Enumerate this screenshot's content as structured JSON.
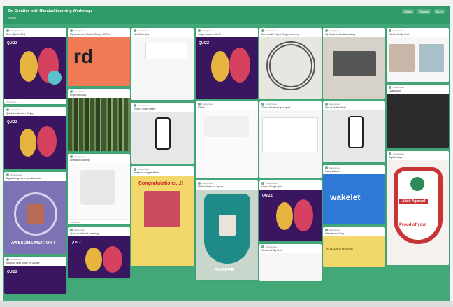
{
  "board": {
    "title": "Be Creative with Blended Learning Workshop",
    "subtitle": "Padlet",
    "actions": [
      "Share",
      "Remake",
      "More"
    ]
  },
  "cards": [
    {
      "author": "Anonymous",
      "title": "Zoom Quizz MCQ",
      "footer": "Comments",
      "media": "quizz",
      "logo": "QUIZZ"
    },
    {
      "author": "Anonymous",
      "title": "Quizz Introduction - Enjoy",
      "footer": "",
      "media": "quizz",
      "logo": "QUIZZ"
    },
    {
      "author": "Anonymous",
      "title": "Digital badge for a special mentor",
      "footer": "",
      "media": "purple",
      "caption": "AWESOME MENTOR !"
    },
    {
      "author": "Anonymous",
      "title": "Nearpod Quiz Share on Google",
      "footer": "",
      "media": "quizz",
      "logo": "QUIZZ"
    },
    {
      "author": "Anonymous",
      "title": "My session on Student Study - SRT-ed",
      "footer": "",
      "media": "orange",
      "big": "rd"
    },
    {
      "author": "Anonymous",
      "title": "Project to study",
      "footer": "",
      "media": "forest"
    },
    {
      "author": "Anonymous",
      "title": "Animated Learning",
      "footer": "Comments",
      "media": "form"
    },
    {
      "author": "Anonymous",
      "title": "Quizz on Wakelet Learning",
      "footer": "",
      "media": "quizz",
      "logo": "QUIZZ"
    },
    {
      "author": "Anonymous",
      "title": "WordWall Quiz",
      "footer": "",
      "media": "ui"
    },
    {
      "author": "Anonymous",
      "title": "Using a smart phone",
      "footer": "",
      "media": "phone"
    },
    {
      "author": "Anonymous",
      "title": "Image for congratulation",
      "footer": "",
      "media": "yellow",
      "caption": "Congratulations...!!"
    },
    {
      "author": "Anonymous",
      "title": "Padlet",
      "footer": "",
      "media": "form"
    },
    {
      "author": "Anonymous",
      "title": "Image created with AI",
      "footer": "",
      "media": "quizz",
      "logo": "QUIZZ"
    },
    {
      "author": "Anonymous",
      "title": "Digital Badge for Topper",
      "footer": "",
      "media": "shield",
      "caption": "TOPPER"
    },
    {
      "author": "Anonymous",
      "title": "Sent email / Flyers Ring of Learning",
      "footer": "",
      "media": "mandala"
    },
    {
      "author": "Anonymous",
      "title": "Use of Wordwall quiz game",
      "footer": "",
      "media": "ui"
    },
    {
      "author": "Anonymous",
      "title": "Use of Google Quiz",
      "footer": "",
      "media": "quizz",
      "logo": "QUIZZ"
    },
    {
      "author": "Anonymous",
      "title": "My Student activities sharing",
      "footer": "",
      "media": "laptop"
    },
    {
      "author": "Anonymous",
      "title": "Use of Padlet Study",
      "footer": "",
      "media": "phone"
    },
    {
      "author": "Anonymous",
      "title": "Using Wakelet",
      "footer": "",
      "media": "blue",
      "caption": "wakelet"
    },
    {
      "author": "Anonymous",
      "title": "International Days",
      "footer": "",
      "media": "yellow",
      "caption": "INTERNATIONAL"
    },
    {
      "author": "Anonymous",
      "title": "Wonderful Big Shot",
      "footer": "",
      "media": "ui"
    },
    {
      "author": "Anonymous",
      "title": "Chalkboard",
      "footer": "",
      "media": "dark"
    },
    {
      "author": "Anonymous",
      "title": "Digital badge",
      "footer": "",
      "media": "badge",
      "caption": "Proud of you!",
      "subcaption": "Advit Agarwal"
    }
  ]
}
